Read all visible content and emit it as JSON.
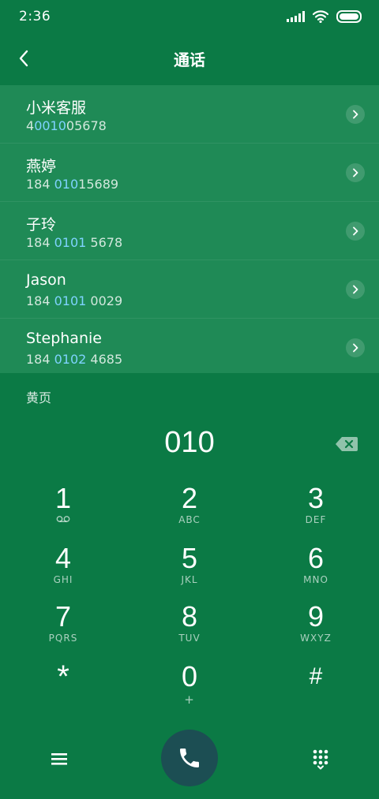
{
  "status": {
    "time": "2:36"
  },
  "header": {
    "title": "通话"
  },
  "contacts": [
    {
      "name": "小米客服",
      "num_pre": "4",
      "num_hl": "0010",
      "num_post": "05678"
    },
    {
      "name": "燕婷",
      "num_pre": "184 ",
      "num_hl": "010",
      "num_post": "15689"
    },
    {
      "name": "子玲",
      "num_pre": "184 ",
      "num_hl": "0101",
      "num_post": " 5678"
    },
    {
      "name": "Jason",
      "num_pre": "184 ",
      "num_hl": "0101",
      "num_post": " 0029"
    },
    {
      "name": "Stephanie",
      "num_pre": "184 ",
      "num_hl": "0102",
      "num_post": " 4685"
    }
  ],
  "yellow_pages": "黄页",
  "dialed": "010",
  "keys": [
    {
      "digit": "1",
      "letters": ""
    },
    {
      "digit": "2",
      "letters": "ABC"
    },
    {
      "digit": "3",
      "letters": "DEF"
    },
    {
      "digit": "4",
      "letters": "GHI"
    },
    {
      "digit": "5",
      "letters": "JKL"
    },
    {
      "digit": "6",
      "letters": "MNO"
    },
    {
      "digit": "7",
      "letters": "PQRS"
    },
    {
      "digit": "8",
      "letters": "TUV"
    },
    {
      "digit": "9",
      "letters": "WXYZ"
    },
    {
      "digit": "*",
      "letters": ""
    },
    {
      "digit": "0",
      "letters": "+"
    },
    {
      "digit": "#",
      "letters": ""
    }
  ],
  "colors": {
    "background": "#0b7a45",
    "list_background": "#1f8a56",
    "highlight": "#7fd3ff",
    "call_button": "#1c4e53"
  },
  "icons": {
    "back": "chevron-left-icon",
    "row_arrow": "chevron-right-icon",
    "backspace": "backspace-icon",
    "voicemail": "voicemail-icon",
    "menu": "menu-icon",
    "call": "phone-icon",
    "dialpad": "dialpad-icon"
  }
}
